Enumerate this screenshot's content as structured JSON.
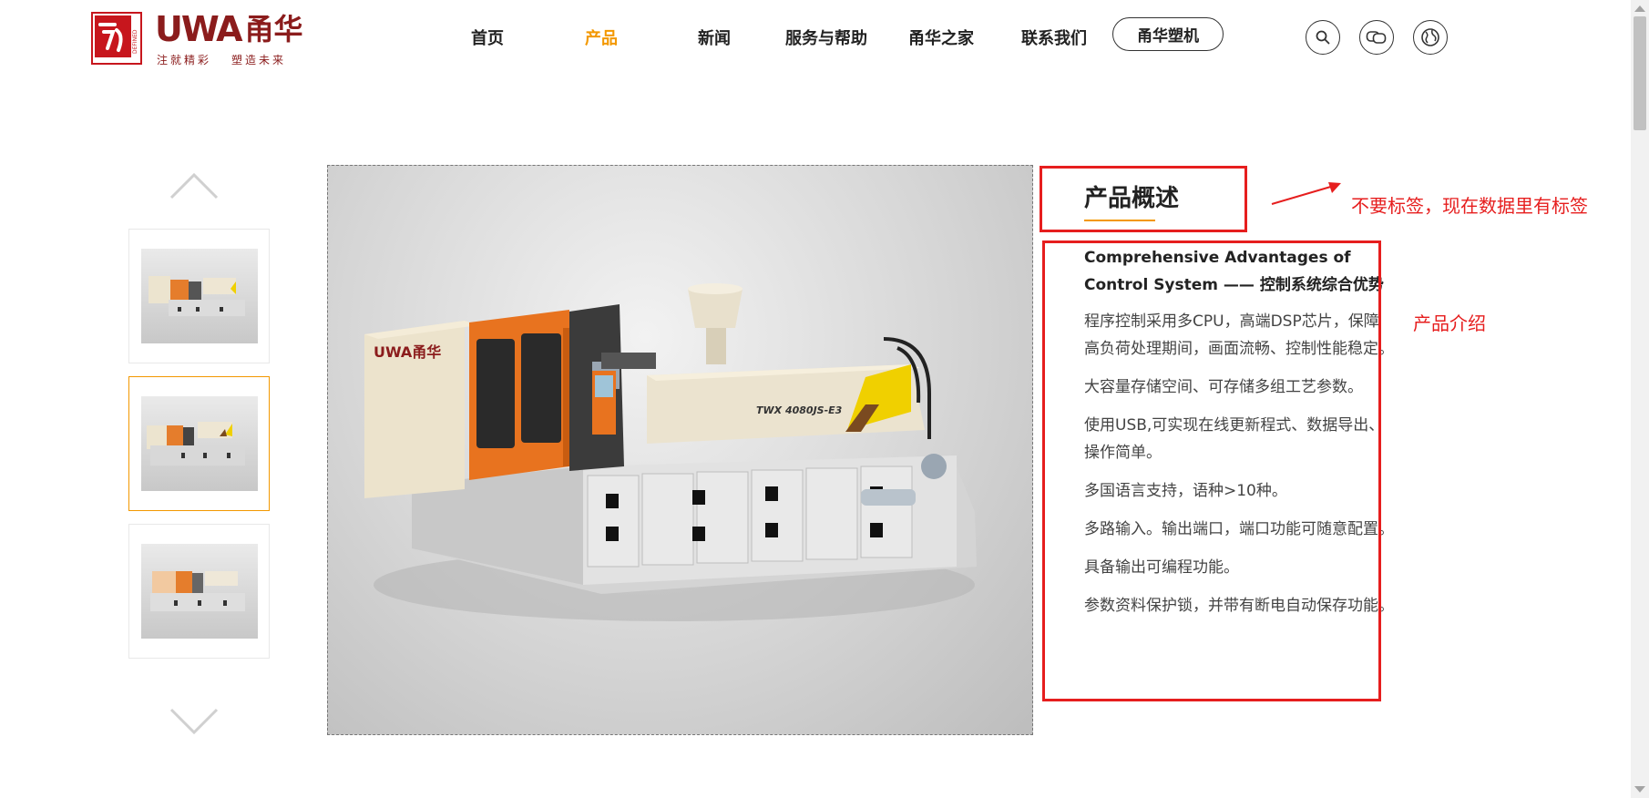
{
  "logo": {
    "brand_latin": "UWA",
    "brand_cn": "甬华",
    "slogan_left": "注就精彩",
    "slogan_right": "塑造未来",
    "mark_text": "DEFINED QUALITY"
  },
  "nav": {
    "items": [
      {
        "label": "首页",
        "active": false
      },
      {
        "label": "产品",
        "active": true
      },
      {
        "label": "新闻",
        "active": false
      },
      {
        "label": "服务与帮助",
        "active": false
      },
      {
        "label": "甬华之家",
        "active": false
      },
      {
        "label": "联系我们",
        "active": false
      }
    ],
    "pill_label": "甬华塑机"
  },
  "header_icons": [
    "search-icon",
    "chat-icon",
    "globe-icon"
  ],
  "gallery": {
    "thumbnails": [
      "thumbnail-1",
      "thumbnail-2",
      "thumbnail-3"
    ],
    "active_index": 1,
    "machine_label_main": "TWX 4080JS-E3",
    "machine_brand": "UWA甬华"
  },
  "product": {
    "tab_title": "产品概述",
    "subtitle": "Comprehensive Advantages of Control System —— 控制系统综合优势",
    "paragraphs": [
      "程序控制采用多CPU，高端DSP芯片，保障高负荷处理期间，画面流畅、控制性能稳定。",
      "大容量存储空间、可存储多组工艺参数。",
      "使用USB,可实现在线更新程式、数据导出、操作简单。",
      "多国语言支持，语种>10种。",
      "多路输入。输出端口，端口功能可随意配置。",
      "具备输出可编程功能。",
      "参数资料保护锁，并带有断电自动保存功能。"
    ]
  },
  "annotations": {
    "no_tag_note": "不要标签，现在数据里有标签",
    "intro_note": "产品介绍",
    "color": "#e61e1e"
  },
  "colors": {
    "accent": "#f39800",
    "brand": "#8b1c1c",
    "annotation": "#e61e1e"
  }
}
